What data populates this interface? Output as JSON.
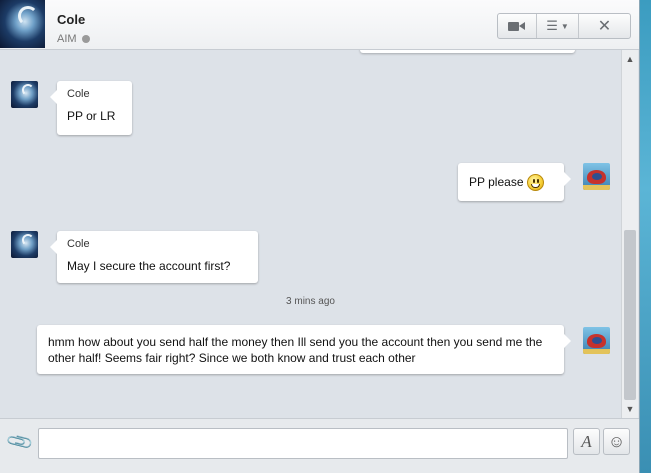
{
  "header": {
    "contact_name": "Cole",
    "status_text": "AIM",
    "status_color": "#9a9a9a",
    "icons": [
      "video-icon",
      "menu-list-icon",
      "chevron-down-icon",
      "close-icon"
    ],
    "close_glyph": "✕",
    "menu_glyph": "☰",
    "caret_glyph": "▼"
  },
  "messages": [
    {
      "sender": "Cole",
      "text": "PP or LR",
      "side": "left"
    },
    {
      "sender": "",
      "text": "PP please",
      "side": "right",
      "emoji": "smiley"
    },
    {
      "sender": "Cole",
      "text": "May I secure the account first?",
      "side": "left"
    },
    {
      "sender": "",
      "text": "hmm how about you send half the money then Ill send you the account then you send me the other half! Seems fair right? Since we both know and trust each other",
      "side": "right"
    }
  ],
  "timestamp": "3 mins ago",
  "scrollbar": {
    "up_glyph": "▲",
    "down_glyph": "▼"
  },
  "input": {
    "value": "",
    "placeholder": "",
    "attach_glyph": "📎",
    "font_glyph": "A",
    "emoji_glyph": "☺"
  },
  "colors": {
    "window_bg": "#dde2e8",
    "bubble_bg": "#ffffff",
    "desktop": "#4aa3c4"
  }
}
